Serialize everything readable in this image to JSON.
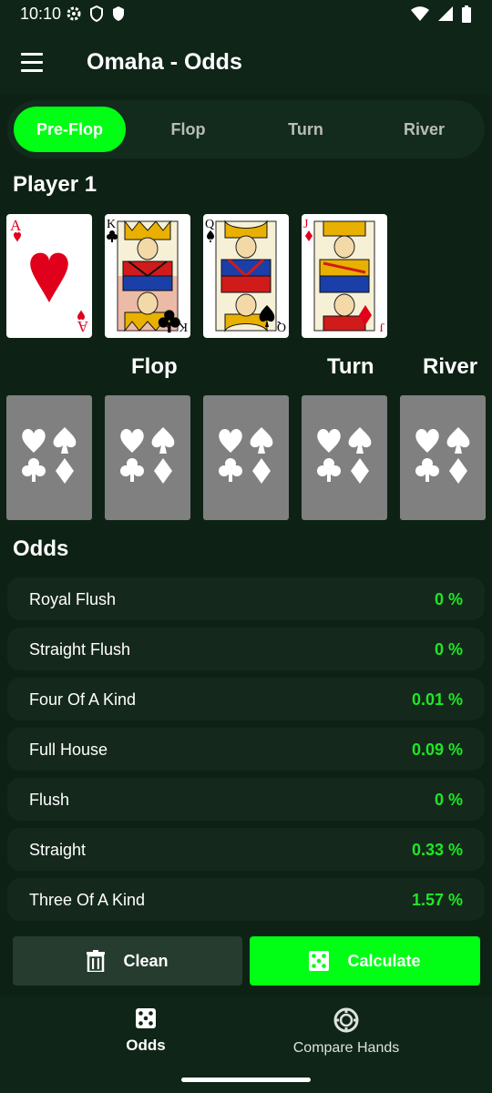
{
  "status": {
    "time": "10:10"
  },
  "app": {
    "title": "Omaha - Odds"
  },
  "stages": [
    "Pre-Flop",
    "Flop",
    "Turn",
    "River"
  ],
  "active_stage": "Pre-Flop",
  "player": {
    "title": "Player 1",
    "cards": [
      {
        "rank": "A",
        "suit": "hearts",
        "color": "#e0001b"
      },
      {
        "rank": "K",
        "suit": "clubs",
        "color": "#000000"
      },
      {
        "rank": "Q",
        "suit": "spades",
        "color": "#000000"
      },
      {
        "rank": "J",
        "suit": "diamonds",
        "color": "#e0001b"
      }
    ]
  },
  "board": {
    "flop_label": "Flop",
    "turn_label": "Turn",
    "river_label": "River"
  },
  "odds": {
    "title": "Odds",
    "rows": [
      {
        "name": "Royal Flush",
        "value": "0 %"
      },
      {
        "name": "Straight Flush",
        "value": "0 %"
      },
      {
        "name": "Four Of A Kind",
        "value": "0.01 %"
      },
      {
        "name": "Full House",
        "value": "0.09 %"
      },
      {
        "name": "Flush",
        "value": "0 %"
      },
      {
        "name": "Straight",
        "value": "0.33 %"
      },
      {
        "name": "Three Of A Kind",
        "value": "1.57 %"
      }
    ]
  },
  "actions": {
    "clean_label": "Clean",
    "calculate_label": "Calculate"
  },
  "nav": {
    "odds_label": "Odds",
    "compare_label": "Compare Hands"
  },
  "colors": {
    "accent": "#00ff14",
    "value_green": "#1de825",
    "background": "#0d2214"
  }
}
